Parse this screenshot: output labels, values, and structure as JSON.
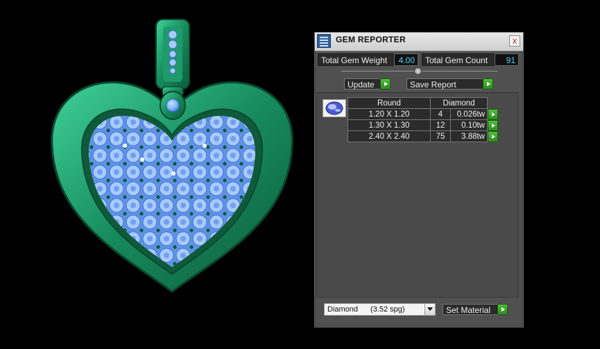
{
  "window": {
    "title": "GEM REPORTER",
    "close_label": "x"
  },
  "stats": {
    "weight_label": "Total Gem Weight",
    "weight_value": "4.00",
    "count_label": "Total Gem Count",
    "count_value": "91"
  },
  "buttons": {
    "update_label": "Update",
    "save_report_label": "Save Report",
    "set_material_label": "Set Material"
  },
  "table": {
    "shape_header": "Round",
    "material_header": "Diamond",
    "rows": [
      {
        "size": "1.20 X 1.20",
        "count": "4",
        "weight": "0.026tw"
      },
      {
        "size": "1.30 X 1.30",
        "count": "12",
        "weight": "0.10tw"
      },
      {
        "size": "2.40 X 2.40",
        "count": "75",
        "weight": "3.88tw"
      }
    ]
  },
  "material": {
    "selected_name": "Diamond",
    "selected_spg": "(3.52 spg)"
  },
  "colors": {
    "metal": "#1f8f63",
    "gem": "#7fb4ff",
    "accent_value": "#55d0ff",
    "go_button": "#3aa52c"
  },
  "icons": {
    "app": "gem-reporter-icon",
    "thumb": "round-gem-icon"
  }
}
